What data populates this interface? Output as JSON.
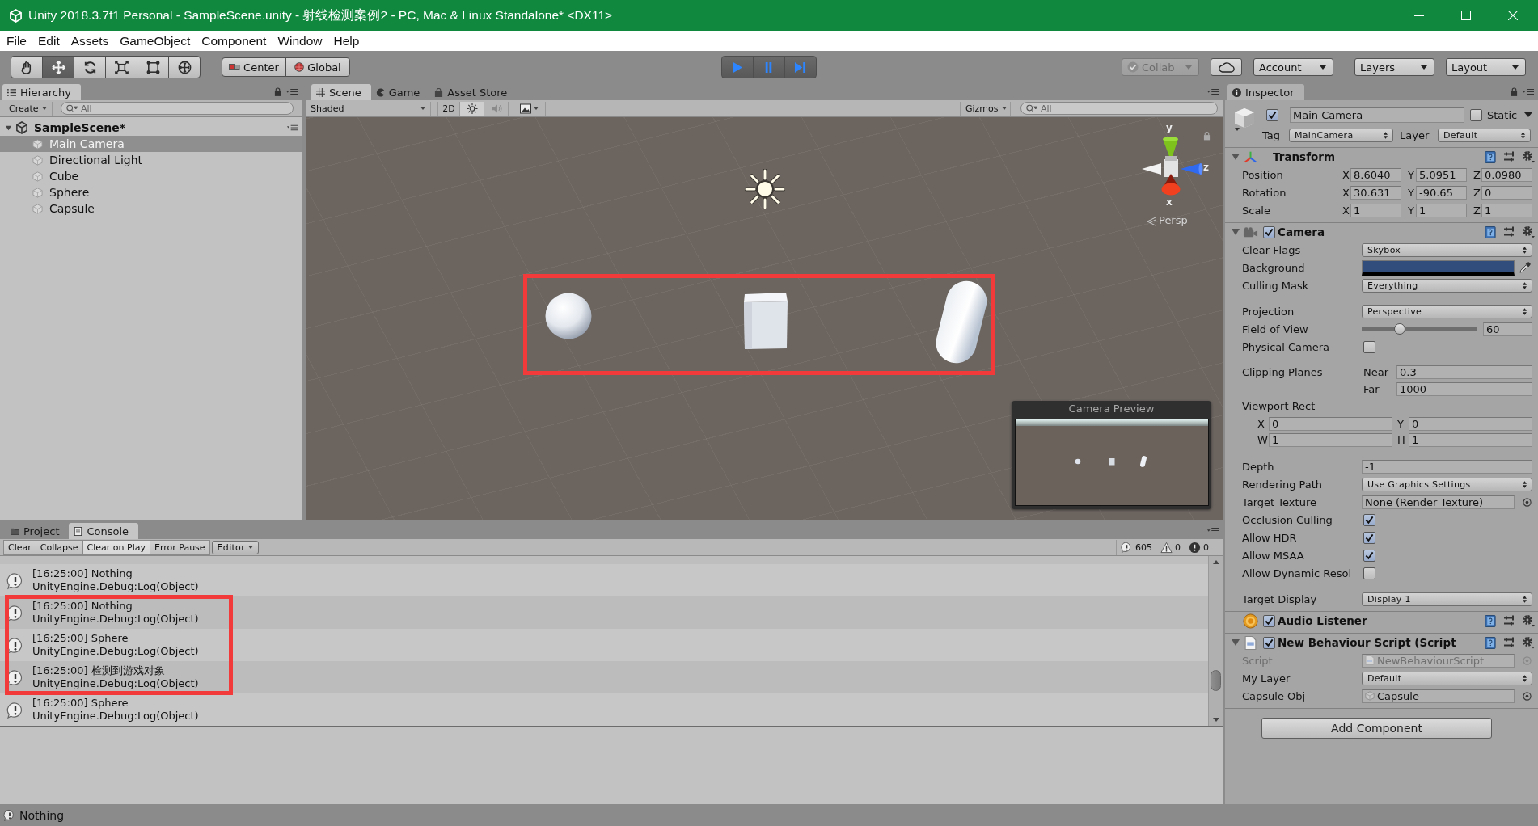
{
  "window": {
    "title": "Unity 2018.3.7f1 Personal - SampleScene.unity - 射线检测案例2 - PC, Mac & Linux Standalone* <DX11>"
  },
  "menu": [
    "File",
    "Edit",
    "Assets",
    "GameObject",
    "Component",
    "Window",
    "Help"
  ],
  "toolbar": {
    "tools": [
      {
        "kind": "hand",
        "selected": false
      },
      {
        "kind": "move",
        "selected": true
      },
      {
        "kind": "rotate",
        "selected": false
      },
      {
        "kind": "scale",
        "selected": false
      },
      {
        "kind": "rect",
        "selected": false
      },
      {
        "kind": "transform",
        "selected": false
      }
    ],
    "pivot": [
      {
        "kind": "center",
        "label": "Center"
      },
      {
        "kind": "global",
        "label": "Global"
      }
    ],
    "play_controls": [
      {
        "kind": "play",
        "on": true
      },
      {
        "kind": "pause",
        "on": true
      },
      {
        "kind": "step",
        "on": true
      }
    ],
    "collab": {
      "label": "Collab",
      "disabled": true
    },
    "menus": [
      {
        "kind": "cloud"
      },
      {
        "kind": "dropdown",
        "label": "Account"
      },
      {
        "kind": "dropdown",
        "label": "Layers"
      },
      {
        "kind": "dropdown",
        "label": "Layout"
      }
    ]
  },
  "hierarchy": {
    "tab": "Hierarchy",
    "create": "Create",
    "search_placeholder": "All",
    "scene": {
      "name": "SampleScene*",
      "expanded": true,
      "children": [
        {
          "name": "Main Camera",
          "selected": true
        },
        {
          "name": "Directional Light",
          "selected": false
        },
        {
          "name": "Cube",
          "selected": false
        },
        {
          "name": "Sphere",
          "selected": false
        },
        {
          "name": "Capsule",
          "selected": false
        }
      ]
    }
  },
  "scene_view": {
    "tabs": [
      {
        "kind": "scene",
        "label": "Scene",
        "selected": true
      },
      {
        "kind": "game",
        "label": "Game",
        "selected": false
      },
      {
        "kind": "store",
        "label": "Asset Store",
        "selected": false
      }
    ],
    "shading": "Shaded",
    "toggles": [
      {
        "kind": "dimension",
        "label": "2D",
        "on": false
      },
      {
        "kind": "lighting",
        "on": true
      },
      {
        "kind": "audio",
        "on": false
      },
      {
        "kind": "effects",
        "on": false
      }
    ],
    "gizmos": "Gizmos",
    "search_placeholder": "All",
    "objects": [
      {
        "kind": "light"
      },
      {
        "kind": "sphere"
      },
      {
        "kind": "cube"
      },
      {
        "kind": "capsule"
      }
    ],
    "highlight_box": true,
    "axes": [
      "y",
      "z",
      "x"
    ],
    "projection": "Persp",
    "camera_preview": {
      "title": "Camera Preview"
    }
  },
  "inspector": {
    "tab": "Inspector",
    "object": {
      "active": true,
      "name": "Main Camera",
      "static": false,
      "static_label": "Static",
      "tag_label": "Tag",
      "tag": "MainCamera",
      "layer_label": "Layer",
      "layer": "Default"
    },
    "components": [
      {
        "kind": "transform",
        "title": "Transform",
        "expanded": true,
        "rows": [
          {
            "kind": "vector3",
            "label": "Position",
            "fields": [
              {
                "axis": "X",
                "value": "8.6040"
              },
              {
                "axis": "Y",
                "value": "5.0951"
              },
              {
                "axis": "Z",
                "value": "0.0980"
              }
            ]
          },
          {
            "kind": "vector3",
            "label": "Rotation",
            "fields": [
              {
                "axis": "X",
                "value": "30.631"
              },
              {
                "axis": "Y",
                "value": "-90.65"
              },
              {
                "axis": "Z",
                "value": "0"
              }
            ]
          },
          {
            "kind": "vector3",
            "label": "Scale",
            "fields": [
              {
                "axis": "X",
                "value": "1"
              },
              {
                "axis": "Y",
                "value": "1"
              },
              {
                "axis": "Z",
                "value": "1"
              }
            ]
          }
        ]
      },
      {
        "kind": "camera",
        "title": "Camera",
        "expanded": true,
        "enabled": true,
        "rows": [
          {
            "kind": "dropdown",
            "label": "Clear Flags",
            "value": "Skybox"
          },
          {
            "kind": "color",
            "label": "Background",
            "color": "#304d7c"
          },
          {
            "kind": "dropdown",
            "label": "Culling Mask",
            "value": "Everything"
          },
          {
            "kind": "dropdown",
            "label": "Projection",
            "value": "Perspective",
            "space_before": true
          },
          {
            "kind": "slider",
            "label": "Field of View",
            "level": 0.33,
            "value": "60"
          },
          {
            "kind": "checkbox",
            "label": "Physical Camera",
            "checked": false
          },
          {
            "kind": "near_far",
            "label": "Clipping Planes",
            "space_before": true,
            "fields": [
              {
                "label": "Near",
                "value": "0.3"
              },
              {
                "label": "Far",
                "value": "1000"
              }
            ]
          },
          {
            "kind": "rect",
            "label": "Viewport Rect",
            "fields": [
              {
                "axis": "X",
                "value": "0"
              },
              {
                "axis": "Y",
                "value": "0"
              },
              {
                "axis": "W",
                "value": "1"
              },
              {
                "axis": "H",
                "value": "1"
              }
            ]
          },
          {
            "kind": "field",
            "label": "Depth",
            "value": "-1",
            "space_before": true
          },
          {
            "kind": "dropdown",
            "label": "Rendering Path",
            "value": "Use Graphics Settings"
          },
          {
            "kind": "object",
            "label": "Target Texture",
            "value": "None (Render Texture)"
          },
          {
            "kind": "checkbox",
            "label": "Occlusion Culling",
            "checked": true
          },
          {
            "kind": "checkbox",
            "label": "Allow HDR",
            "checked": true
          },
          {
            "kind": "checkbox",
            "label": "Allow MSAA",
            "checked": true
          },
          {
            "kind": "checkbox",
            "label": "Allow Dynamic Resol",
            "checked": false
          },
          {
            "kind": "dropdown",
            "label": "Target Display",
            "value": "Display 1",
            "space_before": true
          }
        ]
      },
      {
        "kind": "audio_listener",
        "title": "Audio Listener",
        "enabled": true
      },
      {
        "kind": "script",
        "title": "New Behaviour Script (Script",
        "expanded": true,
        "enabled": true,
        "rows": [
          {
            "kind": "script_ref",
            "label": "Script",
            "value": "NewBehaviourScript",
            "disabled": true
          },
          {
            "kind": "dropdown",
            "label": "My Layer",
            "value": "Default",
            "disabled": false
          },
          {
            "kind": "object_ref",
            "label": "Capsule Obj",
            "value": "Capsule",
            "disabled": false
          }
        ]
      }
    ],
    "add_component": "Add Component"
  },
  "console": {
    "tabs": [
      {
        "kind": "project",
        "label": "Project",
        "selected": false
      },
      {
        "kind": "console",
        "label": "Console",
        "selected": true
      }
    ],
    "buttons": [
      {
        "kind": "button",
        "label": "Clear"
      },
      {
        "kind": "toggle",
        "label": "Collapse",
        "on": false
      },
      {
        "kind": "toggle",
        "label": "Clear on Play",
        "on": true
      },
      {
        "kind": "toggle",
        "label": "Error Pause",
        "on": false
      },
      {
        "kind": "dropdown",
        "label": "Editor"
      }
    ],
    "counters": [
      {
        "kind": "info",
        "count": "605"
      },
      {
        "kind": "warning",
        "count": "0"
      },
      {
        "kind": "error",
        "count": "0"
      }
    ],
    "entries": [
      {
        "message": "[16:25:00] Nothing",
        "trace": "UnityEngine.Debug:Log(Object)",
        "highlighted": false
      },
      {
        "message": "[16:25:00] Nothing",
        "trace": "UnityEngine.Debug:Log(Object)",
        "highlighted": true
      },
      {
        "message": "[16:25:00] Sphere",
        "trace": "UnityEngine.Debug:Log(Object)",
        "highlighted": true
      },
      {
        "message": "[16:25:00] 检测到游戏对象",
        "trace": "UnityEngine.Debug:Log(Object)",
        "highlighted": true
      },
      {
        "message": "[16:25:00] Sphere",
        "trace": "UnityEngine.Debug:Log(Object)",
        "highlighted": false
      }
    ]
  },
  "status_bar": {
    "message": "Nothing"
  }
}
